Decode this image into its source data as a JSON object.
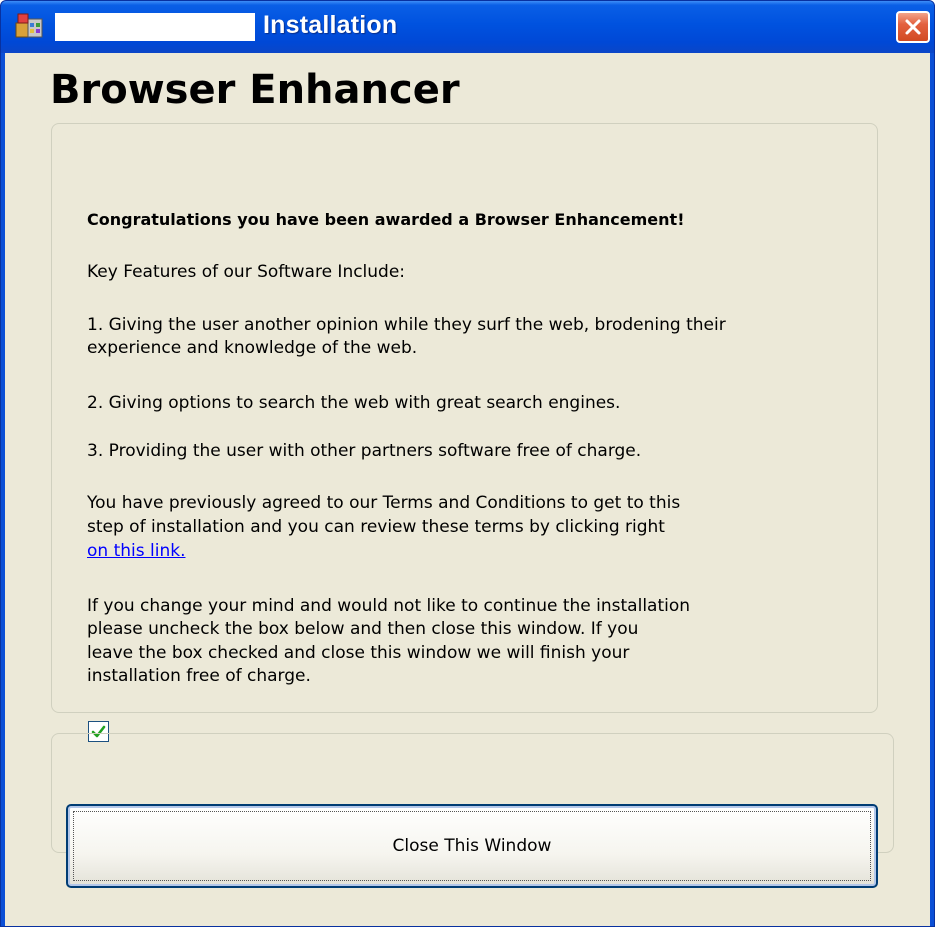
{
  "window": {
    "title": "Installation",
    "close_icon": "close-icon",
    "app_icon": "installer-icon"
  },
  "content": {
    "heading": "Browser Enhancer",
    "congrats": "Congratulations you have been awarded a Browser Enhancement!",
    "features_intro": "Key Features of our Software Include:",
    "feature_1_line_1": "1. Giving the user another opinion while they surf the web, brodening their",
    "feature_1_line_2": "experience and knowledge of the web.",
    "feature_2": "2. Giving options to search the web with great search engines.",
    "feature_3": "3. Providing the user with other partners software free of charge.",
    "terms_line_1": "You have previously agreed to our Terms and Conditions to get to this",
    "terms_line_2": "step of installation and you can review these terms by clicking right",
    "terms_link": "on this link.",
    "uncheck_line_1": "If you change your mind and would not like to continue the installation",
    "uncheck_line_2": "please uncheck the box below and then close this window. If you",
    "uncheck_line_3": "leave the box checked and close this window we will finish your",
    "uncheck_line_4": "installation free of charge.",
    "checkbox_checked": true
  },
  "footer": {
    "close_button_label": "Close This Window"
  },
  "colors": {
    "titlebar": "#0052df",
    "client_background": "#ece9d8",
    "link": "#0000ff",
    "checkmark": "#21a121"
  }
}
